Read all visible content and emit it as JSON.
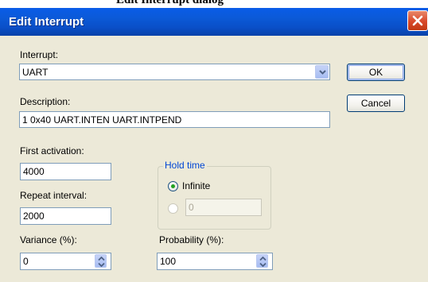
{
  "page_caption": "Edit Interrupt dialog",
  "dialog": {
    "title": "Edit Interrupt",
    "close_icon": "close-icon"
  },
  "interrupt": {
    "label": "Interrupt:",
    "value": "UART"
  },
  "description": {
    "label": "Description:",
    "value": "1 0x40 UART.INTEN UART.INTPEND"
  },
  "first_activation": {
    "label": "First activation:",
    "value": "4000"
  },
  "repeat_interval": {
    "label": "Repeat interval:",
    "value": "2000"
  },
  "variance": {
    "label": "Variance (%):",
    "value": "0"
  },
  "hold_time": {
    "legend": "Hold time",
    "infinite_label": "Infinite",
    "infinite_selected": true,
    "custom_value": "0"
  },
  "probability": {
    "label": "Probability (%):",
    "value": "100"
  },
  "buttons": {
    "ok": "OK",
    "cancel": "Cancel"
  },
  "colors": {
    "titlebar": "#0a5ce8",
    "dialog_bg": "#ece9d8",
    "group_legend": "#0046d5",
    "close_button": "#d8482a"
  }
}
